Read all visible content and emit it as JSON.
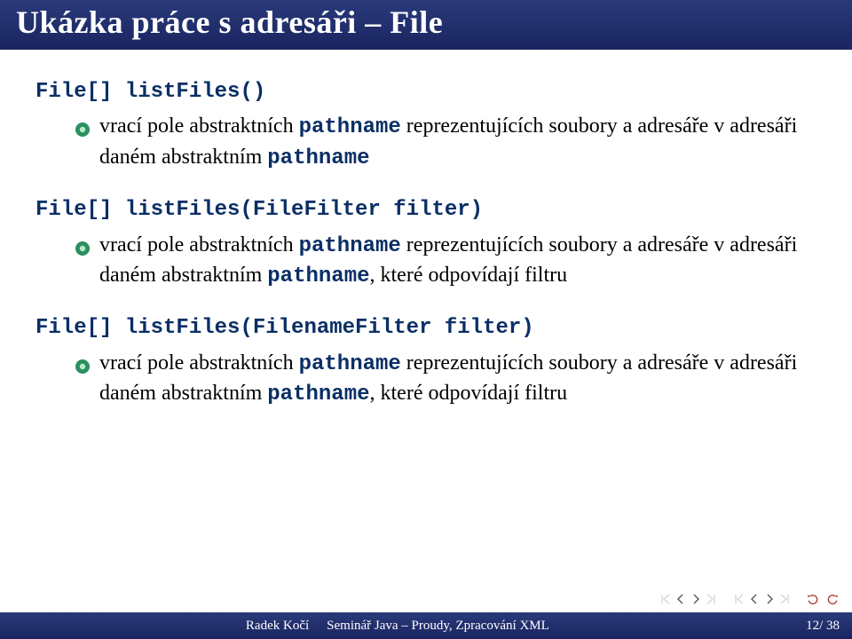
{
  "title": "Ukázka práce s adresáři – File",
  "sections": [
    {
      "code": "File[] listFiles()",
      "bullet_prefix": "vrací pole abstraktních ",
      "bullet_kw1": "pathname",
      "bullet_mid1": " reprezentujících soubory a adresáře v adresáři daném abstraktním ",
      "bullet_kw2": "pathname",
      "bullet_suffix": ""
    },
    {
      "code": "File[] listFiles(FileFilter filter)",
      "bullet_prefix": "vrací pole abstraktních ",
      "bullet_kw1": "pathname",
      "bullet_mid1": " reprezentujících soubory a adresáře v adresáři daném abstraktním ",
      "bullet_kw2": "pathname",
      "bullet_suffix": ", které odpovídají filtru"
    },
    {
      "code": "File[] listFiles(FilenameFilter filter)",
      "bullet_prefix": "vrací pole abstraktních ",
      "bullet_kw1": "pathname",
      "bullet_mid1": " reprezentujících soubory a adresáře v adresáři daném abstraktním ",
      "bullet_kw2": "pathname",
      "bullet_suffix": ", které odpovídají filtru"
    }
  ],
  "footer": {
    "author": "Radek Kočí",
    "talk": "Seminář Java – Proudy, Zpracování XML",
    "page": "12/ 38"
  },
  "colors": {
    "header_bg": "#1a2560",
    "code": "#0a2f66",
    "bullet": "#2a9060"
  }
}
